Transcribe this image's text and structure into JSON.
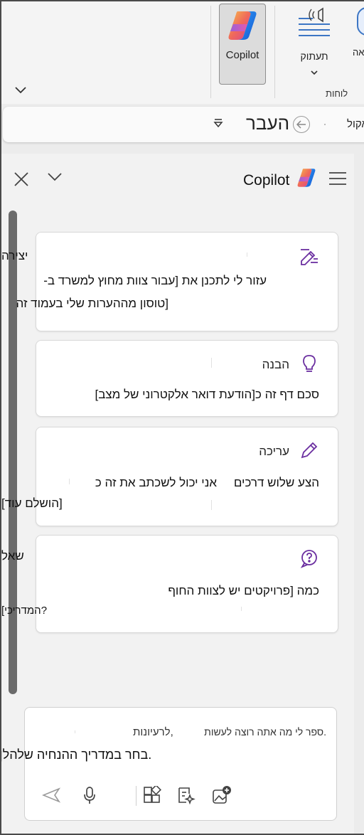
{
  "ribbon": {
    "copilot_label": "Copilot",
    "dictate_label": "תעתוק",
    "cut_label": "אה",
    "group_label": "לוחות"
  },
  "nav": {
    "history_label": "העבר",
    "left_text": "אקול"
  },
  "pane": {
    "title": "Copilot",
    "cards": [
      {
        "icon": "pen-lines-icon",
        "title": "",
        "overflow_title": "יצירה",
        "line1": "עזור לי לתכנן את [עבור צוות מחוץ למשרד ב-",
        "line2": "[טוסון מההערות שלי בעמוד זה"
      },
      {
        "icon": "lightbulb-icon",
        "title": "הבנה",
        "line1": "סכם דף זה כ[הודעת דואר אלקטרוני של מצב]"
      },
      {
        "icon": "pencil-icon",
        "title": "עריכה",
        "line1": "הצע שלוש דרכים",
        "line1b": "אני יכול לשכתב את זה כ",
        "line2": "[הושלם עוד]"
      },
      {
        "icon": "question-bubble-icon",
        "title": "",
        "overflow_title": "שאל",
        "line1": "כמה [פרויקטים יש לצוות החוף",
        "line2": "[המדריכי?"
      }
    ]
  },
  "composer": {
    "line1": "ספר לי מה אתה רוצה לעשות.",
    "line1b": "לרעיונות,",
    "line2": "בחר במדריך ההנחיה שלהלן."
  },
  "colors": {
    "accent_purple": "#6b2fa0",
    "copilot_btn_bg": "#dcdcdc",
    "pane_bg": "#f2f2f2",
    "card_bg": "#ffffff"
  }
}
